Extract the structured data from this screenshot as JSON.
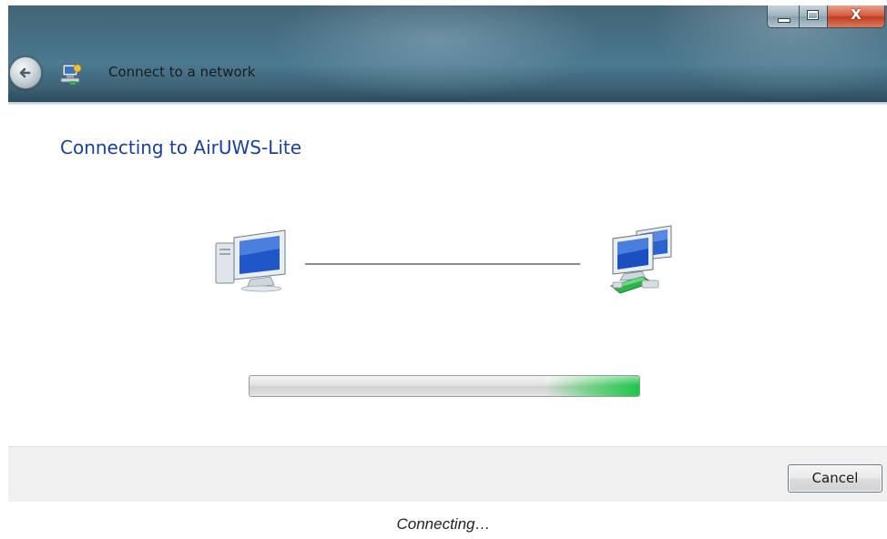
{
  "window": {
    "title": "Connect to a network",
    "caption_buttons": {
      "minimize": "minimize-icon",
      "maximize": "maximize-icon",
      "close": "X"
    }
  },
  "main": {
    "heading": "Connecting to AirUWS-Lite",
    "source_icon": "computer-icon",
    "target_icon": "network-icon",
    "progress": {
      "type": "indeterminate-marquee",
      "accent": "#1fc64a"
    }
  },
  "footer": {
    "cancel_label": "Cancel"
  },
  "caption": "Connecting…",
  "colors": {
    "heading": "#1c3f95",
    "titlebar": "#3f6a80",
    "progress_green": "#1fc64a",
    "close_red": "#c23d1f"
  }
}
